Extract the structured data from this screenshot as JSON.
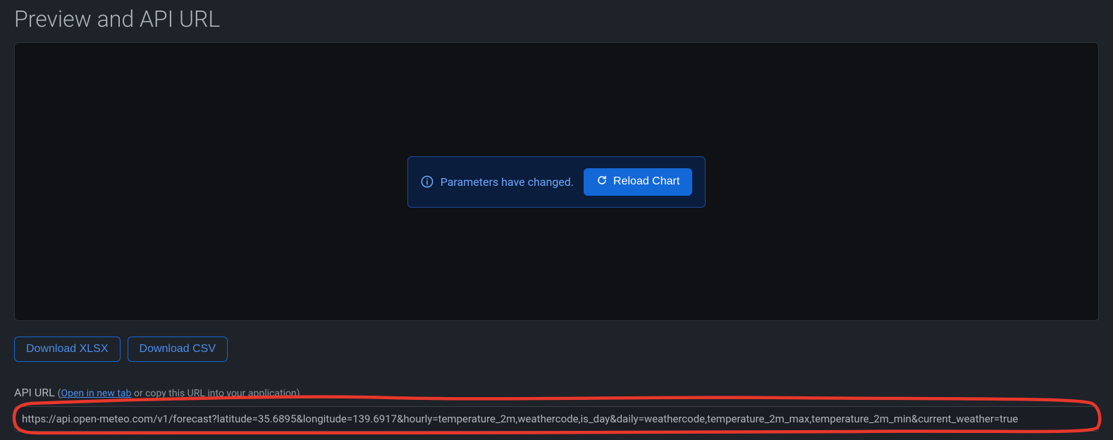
{
  "header": {
    "title": "Preview and API URL"
  },
  "alert": {
    "message": "Parameters have changed.",
    "reload_label": "Reload Chart"
  },
  "downloads": {
    "xlsx_label": "Download XLSX",
    "csv_label": "Download CSV"
  },
  "api": {
    "label": "API URL",
    "open_tab_label": "Open in new tab",
    "hint_suffix": " or copy this URL into your application)",
    "url_value": "https://api.open-meteo.com/v1/forecast?latitude=35.6895&longitude=139.6917&hourly=temperature_2m,weathercode,is_day&daily=weathercode,temperature_2m_max,temperature_2m_min&current_weather=true"
  }
}
